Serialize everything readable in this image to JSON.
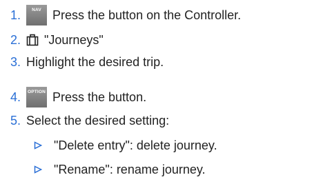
{
  "steps": [
    {
      "number": "1.",
      "key_label": "NAV",
      "text": "Press the button on the Controller."
    },
    {
      "number": "2.",
      "icon": "briefcase-icon",
      "text": "\"Journeys\""
    },
    {
      "number": "3.",
      "text": "Highlight the desired trip."
    },
    {
      "number": "4.",
      "key_label": "OPTION",
      "text": "Press the button."
    },
    {
      "number": "5.",
      "text": "Select the desired setting:"
    }
  ],
  "settings": [
    {
      "marker": "triangle-bullet-icon",
      "text": "\"Delete entry\": delete journey."
    },
    {
      "marker": "triangle-bullet-icon",
      "text": "\"Rename\": rename journey."
    }
  ],
  "colors": {
    "number": "#2a6fd6",
    "bullet": "#2a6fd6",
    "text": "#222222",
    "key_background": "#808080",
    "key_label": "#ffffff"
  }
}
